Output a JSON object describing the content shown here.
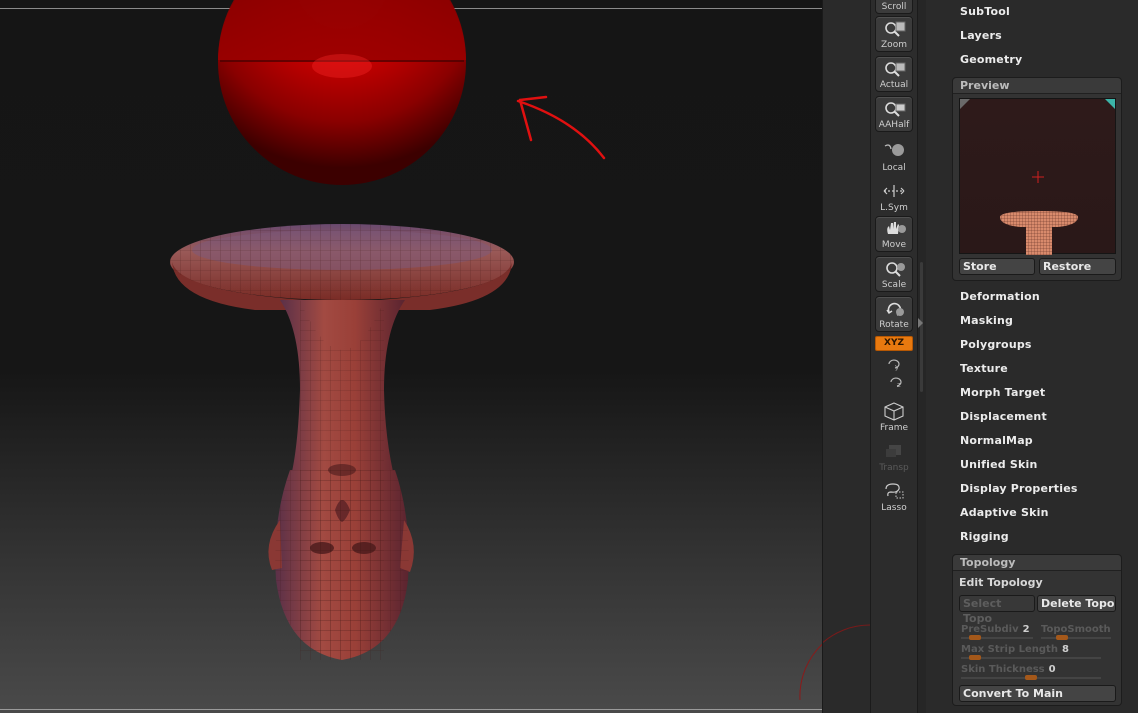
{
  "palette": {
    "items_top": [
      "SubTool",
      "Layers",
      "Geometry"
    ],
    "preview": {
      "title": "Preview",
      "store_label": "Store",
      "restore_label": "Restore"
    },
    "items_middle": [
      "Deformation",
      "Masking",
      "Polygroups",
      "Texture",
      "Morph Target",
      "Displacement",
      "NormalMap",
      "Unified Skin",
      "Display Properties",
      "Adaptive Skin",
      "Rigging"
    ],
    "topology": {
      "title": "Topology",
      "edit_label": "Edit Topology",
      "select_topo_label": "Select Topo",
      "delete_topo_label": "Delete Topo",
      "presubdiv_label": "PreSubdiv",
      "presubdiv_value": "2",
      "presubdiv_level": 0.2,
      "toposmooth_label": "TopoSmooth",
      "toposmooth_level": 0.3,
      "max_strip_label": "Max Strip Length",
      "max_strip_value": "8",
      "max_strip_level": 0.1,
      "skin_thickness_label": "Skin Thickness",
      "skin_thickness_value": "0",
      "skin_thickness_level": 0.5,
      "convert_label": "Convert To Main"
    }
  },
  "shelf": {
    "scroll_label": "Scroll",
    "zoom_label": "Zoom",
    "actual_label": "Actual",
    "aahalf_label": "AAHalf",
    "local_label": "Local",
    "lsym_label": "L.Sym",
    "move_label": "Move",
    "scale_label": "Scale",
    "rotate_label": "Rotate",
    "xyz_label": "XYZ",
    "frame_label": "Frame",
    "transp_label": "Transp",
    "lasso_label": "Lasso"
  },
  "colors": {
    "accent_orange": "#e8790f",
    "sphere_red": "#c00000",
    "annotation_red": "#e01010",
    "mesh_red": "#8a2a24"
  },
  "viewport": {
    "annotation": "red-arrow"
  }
}
